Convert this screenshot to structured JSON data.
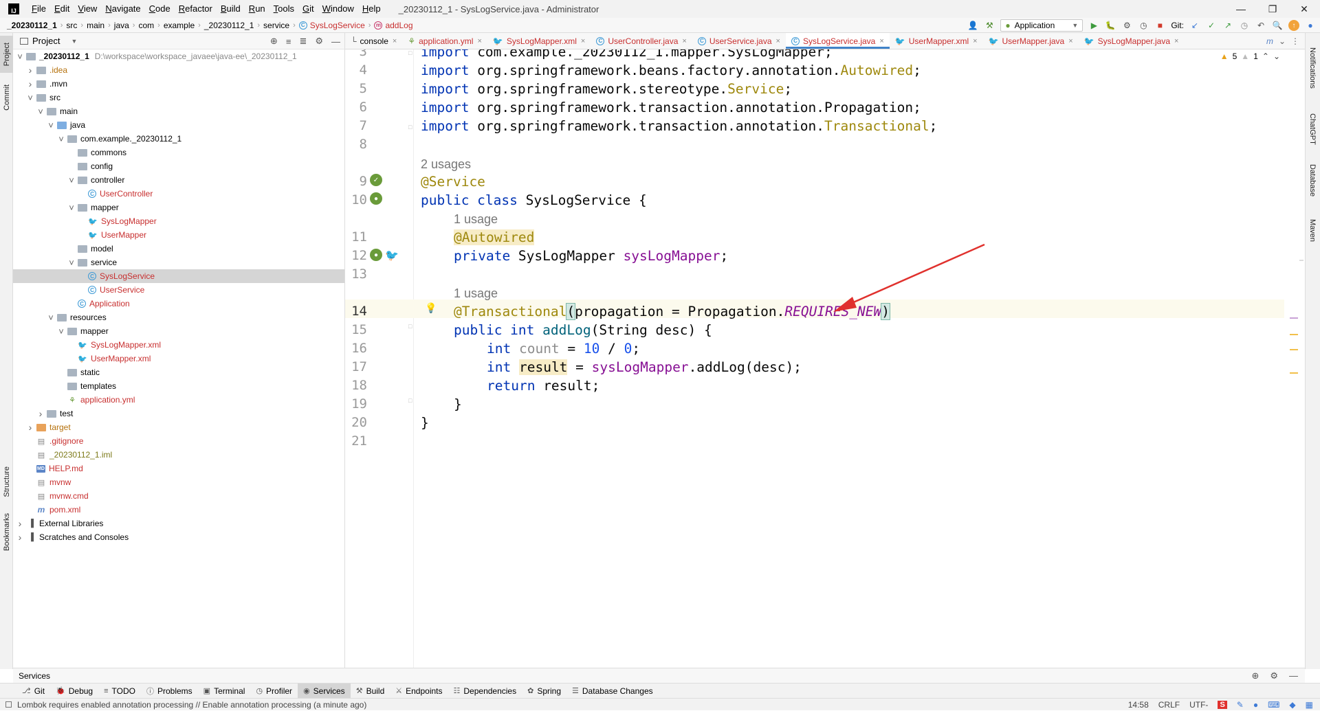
{
  "titlebar": {
    "menus": [
      "File",
      "Edit",
      "View",
      "Navigate",
      "Code",
      "Refactor",
      "Build",
      "Run",
      "Tools",
      "Git",
      "Window",
      "Help"
    ],
    "title": "_20230112_1 - SysLogService.java - Administrator"
  },
  "navbar": {
    "crumbs": [
      "_20230112_1",
      "src",
      "main",
      "java",
      "com",
      "example",
      "_20230112_1",
      "service",
      "SysLogService",
      "addLog"
    ],
    "run_config": "Application",
    "git_label": "Git:"
  },
  "left_stripe": {
    "tabs": [
      "Project",
      "Commit",
      "Structure",
      "Bookmarks"
    ]
  },
  "right_stripe": {
    "tabs": [
      "Notifications",
      "ChatGPT",
      "Database",
      "Maven"
    ]
  },
  "project": {
    "title": "Project",
    "root_path": "D:\\workspace\\workspace_javaee\\java-ee\\_20230112_1",
    "items": [
      {
        "label": "_20230112_1",
        "depth": 0,
        "arrow": "open",
        "icon": "folder",
        "color": "bold"
      },
      {
        "label": ".idea",
        "depth": 1,
        "arrow": "closed",
        "icon": "folder",
        "color": "orange"
      },
      {
        "label": ".mvn",
        "depth": 1,
        "arrow": "closed",
        "icon": "folder",
        "color": "normal"
      },
      {
        "label": "src",
        "depth": 1,
        "arrow": "open",
        "icon": "folder",
        "color": "normal"
      },
      {
        "label": "main",
        "depth": 2,
        "arrow": "open",
        "icon": "folder",
        "color": "normal"
      },
      {
        "label": "java",
        "depth": 3,
        "arrow": "open",
        "icon": "folder-blue",
        "color": "normal"
      },
      {
        "label": "com.example._20230112_1",
        "depth": 4,
        "arrow": "open",
        "icon": "folder",
        "color": "normal"
      },
      {
        "label": "commons",
        "depth": 5,
        "arrow": "none",
        "icon": "folder",
        "color": "normal"
      },
      {
        "label": "config",
        "depth": 5,
        "arrow": "none",
        "icon": "folder",
        "color": "normal"
      },
      {
        "label": "controller",
        "depth": 5,
        "arrow": "open",
        "icon": "folder",
        "color": "normal"
      },
      {
        "label": "UserController",
        "depth": 6,
        "arrow": "none",
        "icon": "java",
        "color": "red"
      },
      {
        "label": "mapper",
        "depth": 5,
        "arrow": "open",
        "icon": "folder",
        "color": "normal"
      },
      {
        "label": "SysLogMapper",
        "depth": 6,
        "arrow": "none",
        "icon": "bird",
        "color": "red"
      },
      {
        "label": "UserMapper",
        "depth": 6,
        "arrow": "none",
        "icon": "bird",
        "color": "red"
      },
      {
        "label": "model",
        "depth": 5,
        "arrow": "none",
        "icon": "folder",
        "color": "normal"
      },
      {
        "label": "service",
        "depth": 5,
        "arrow": "open",
        "icon": "folder",
        "color": "normal"
      },
      {
        "label": "SysLogService",
        "depth": 6,
        "arrow": "none",
        "icon": "java",
        "color": "red",
        "selected": true
      },
      {
        "label": "UserService",
        "depth": 6,
        "arrow": "none",
        "icon": "java",
        "color": "red"
      },
      {
        "label": "Application",
        "depth": 5,
        "arrow": "none",
        "icon": "java",
        "color": "red"
      },
      {
        "label": "resources",
        "depth": 3,
        "arrow": "open",
        "icon": "folder",
        "color": "normal"
      },
      {
        "label": "mapper",
        "depth": 4,
        "arrow": "open",
        "icon": "folder",
        "color": "normal"
      },
      {
        "label": "SysLogMapper.xml",
        "depth": 5,
        "arrow": "none",
        "icon": "bird",
        "color": "red"
      },
      {
        "label": "UserMapper.xml",
        "depth": 5,
        "arrow": "none",
        "icon": "bird",
        "color": "red"
      },
      {
        "label": "static",
        "depth": 4,
        "arrow": "none",
        "icon": "folder",
        "color": "normal"
      },
      {
        "label": "templates",
        "depth": 4,
        "arrow": "none",
        "icon": "folder",
        "color": "normal"
      },
      {
        "label": "application.yml",
        "depth": 4,
        "arrow": "none",
        "icon": "yml",
        "color": "red"
      },
      {
        "label": "test",
        "depth": 2,
        "arrow": "closed",
        "icon": "folder",
        "color": "normal"
      },
      {
        "label": "target",
        "depth": 1,
        "arrow": "closed",
        "icon": "folder-orange",
        "color": "orange"
      },
      {
        "label": ".gitignore",
        "depth": 1,
        "arrow": "none",
        "icon": "file",
        "color": "red"
      },
      {
        "label": "_20230112_1.iml",
        "depth": 1,
        "arrow": "none",
        "icon": "file",
        "color": "olive"
      },
      {
        "label": "HELP.md",
        "depth": 1,
        "arrow": "none",
        "icon": "md",
        "color": "red"
      },
      {
        "label": "mvnw",
        "depth": 1,
        "arrow": "none",
        "icon": "file",
        "color": "red"
      },
      {
        "label": "mvnw.cmd",
        "depth": 1,
        "arrow": "none",
        "icon": "file",
        "color": "red"
      },
      {
        "label": "pom.xml",
        "depth": 1,
        "arrow": "none",
        "icon": "m",
        "color": "red"
      },
      {
        "label": "External Libraries",
        "depth": 0,
        "arrow": "closed",
        "icon": "lib",
        "color": "normal"
      },
      {
        "label": "Scratches and Consoles",
        "depth": 0,
        "arrow": "closed",
        "icon": "lib",
        "color": "normal"
      }
    ]
  },
  "editor": {
    "tabs": [
      {
        "label": "console",
        "icon": "console",
        "color": "normal"
      },
      {
        "label": "application.yml",
        "icon": "yml",
        "color": "red"
      },
      {
        "label": "SysLogMapper.xml",
        "icon": "bird",
        "color": "red"
      },
      {
        "label": "UserController.java",
        "icon": "java",
        "color": "red"
      },
      {
        "label": "UserService.java",
        "icon": "java",
        "color": "red"
      },
      {
        "label": "SysLogService.java",
        "icon": "java",
        "color": "red",
        "active": true
      },
      {
        "label": "UserMapper.xml",
        "icon": "bird",
        "color": "red"
      },
      {
        "label": "UserMapper.java",
        "icon": "bird",
        "color": "red"
      },
      {
        "label": "SysLogMapper.java",
        "icon": "bird",
        "color": "red"
      }
    ],
    "warnings": "5",
    "weak_warnings": "1",
    "line_numbers": [
      "3",
      "4",
      "5",
      "6",
      "7",
      "8",
      "9",
      "10",
      "11",
      "12",
      "13",
      "14",
      "15",
      "16",
      "17",
      "18",
      "19",
      "20",
      "21"
    ],
    "usages": {
      "class": "2 usages",
      "field": "1 usage",
      "method": "1 usage"
    },
    "code": {
      "l3_kw": "import",
      "l3_rest": " com.example._20230112_1.mapper.SysLogMapper;",
      "l4_kw": "import",
      "l4_a": " org.springframework.beans.factory.annotation.",
      "l4_b": "Autowired",
      "l4_c": ";",
      "l5_kw": "import",
      "l5_a": " org.springframework.stereotype.",
      "l5_b": "Service",
      "l5_c": ";",
      "l6_kw": "import",
      "l6_a": " org.springframework.transaction.annotation.Propagation;",
      "l7_kw": "import",
      "l7_a": " org.springframework.transaction.annotation.",
      "l7_b": "Transactional",
      "l7_c": ";",
      "l9": "@Service",
      "l10_kw": "public class",
      "l10_rest": " SysLogService {",
      "l11": "@Autowired",
      "l12_kw": "private",
      "l12_type": " SysLogMapper ",
      "l12_fld": "sysLogMapper",
      "l12_end": ";",
      "l14_ann": "@Transactional",
      "l14_open": "(",
      "l14_mid": "propagation = Propagation.",
      "l14_const": "REQUIRES_NEW",
      "l14_close": ")",
      "l15_kw": "public int",
      "l15_name": " addLog",
      "l15_rest": "(String desc) {",
      "l16_kw": "int",
      "l16_var": " count",
      "l16_eq": " = ",
      "l16_n1": "10",
      "l16_op": " / ",
      "l16_n2": "0",
      "l16_end": ";",
      "l17_kw": "int",
      "l17_var": "result",
      "l17_eq": " = ",
      "l17_fld": "sysLogMapper",
      "l17_rest": ".addLog(desc);",
      "l18_kw": "return",
      "l18_rest": " result;",
      "l19": "}",
      "l20": "}"
    }
  },
  "services_bar": {
    "title": "Services"
  },
  "bottom_tabs": [
    "Git",
    "Debug",
    "TODO",
    "Problems",
    "Terminal",
    "Profiler",
    "Services",
    "Build",
    "Endpoints",
    "Dependencies",
    "Spring",
    "Database Changes"
  ],
  "active_bottom_tab": "Services",
  "status": {
    "message": "Lombok requires enabled annotation processing // Enable annotation processing (a minute ago)",
    "position": "14:58",
    "line_sep": "CRLF",
    "encoding": "UTF-"
  },
  "colors": {
    "accent": "#4083c9",
    "keyword": "#0033b3",
    "annotation": "#9e880d",
    "field": "#871094",
    "number": "#1750eb",
    "arrow": "#e0312d"
  }
}
